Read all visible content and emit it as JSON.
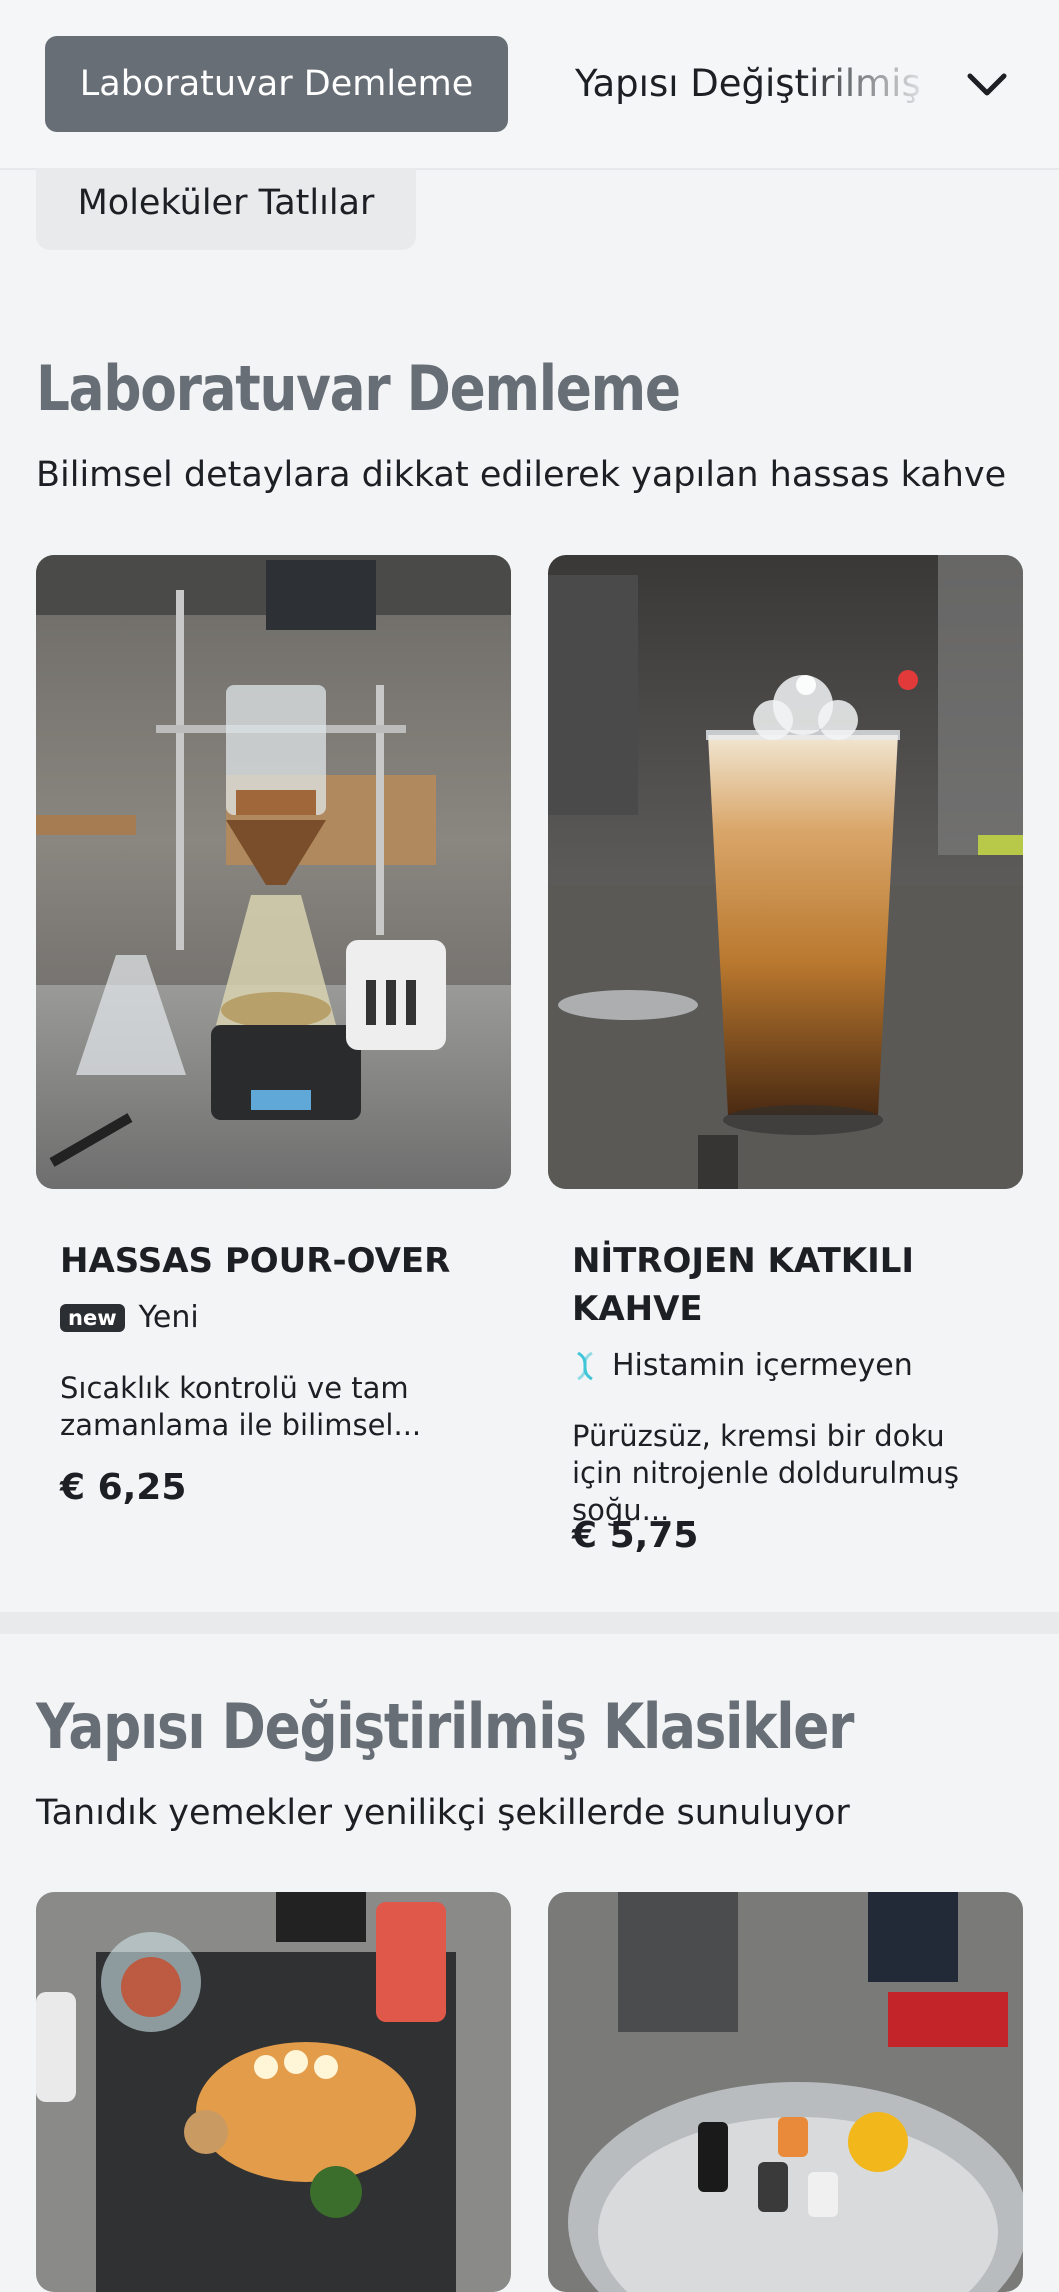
{
  "category_nav": {
    "active": "Laboratuvar Demleme",
    "next": "Yapısı Değiştirilmiş Klasikler",
    "second_row": "Moleküler Tatlılar",
    "chevron_icon": "chevron-down-icon"
  },
  "sections": [
    {
      "title": "Laboratuvar Demleme",
      "subtitle": "Bilimsel detaylara dikkat edilerek yapılan hassas kahve",
      "items": [
        {
          "name": "HASSAS POUR-OVER",
          "badge_icon": "new",
          "badge_label": "Yeni",
          "description": "Sıcaklık kontrolü ve tam zamanlama ile bilimsel...",
          "price": "€ 6,25"
        },
        {
          "name": "NİTROJEN KATKILI KAHVE",
          "badge_icon": "dna-icon",
          "badge_label": "Histamin içermeyen",
          "description": "Pürüzsüz, kremsi bir doku için nitrojenle doldurulmuş soğu...",
          "price": "€ 5,75"
        }
      ]
    },
    {
      "title": "Yapısı Değiştirilmiş Klasikler",
      "subtitle": "Tanıdık yemekler yenilikçi şekillerde sunuluyor"
    }
  ],
  "colors": {
    "accent": "#676e76",
    "background": "#f3f4f6",
    "dna_icon": "#3fc6d8"
  }
}
